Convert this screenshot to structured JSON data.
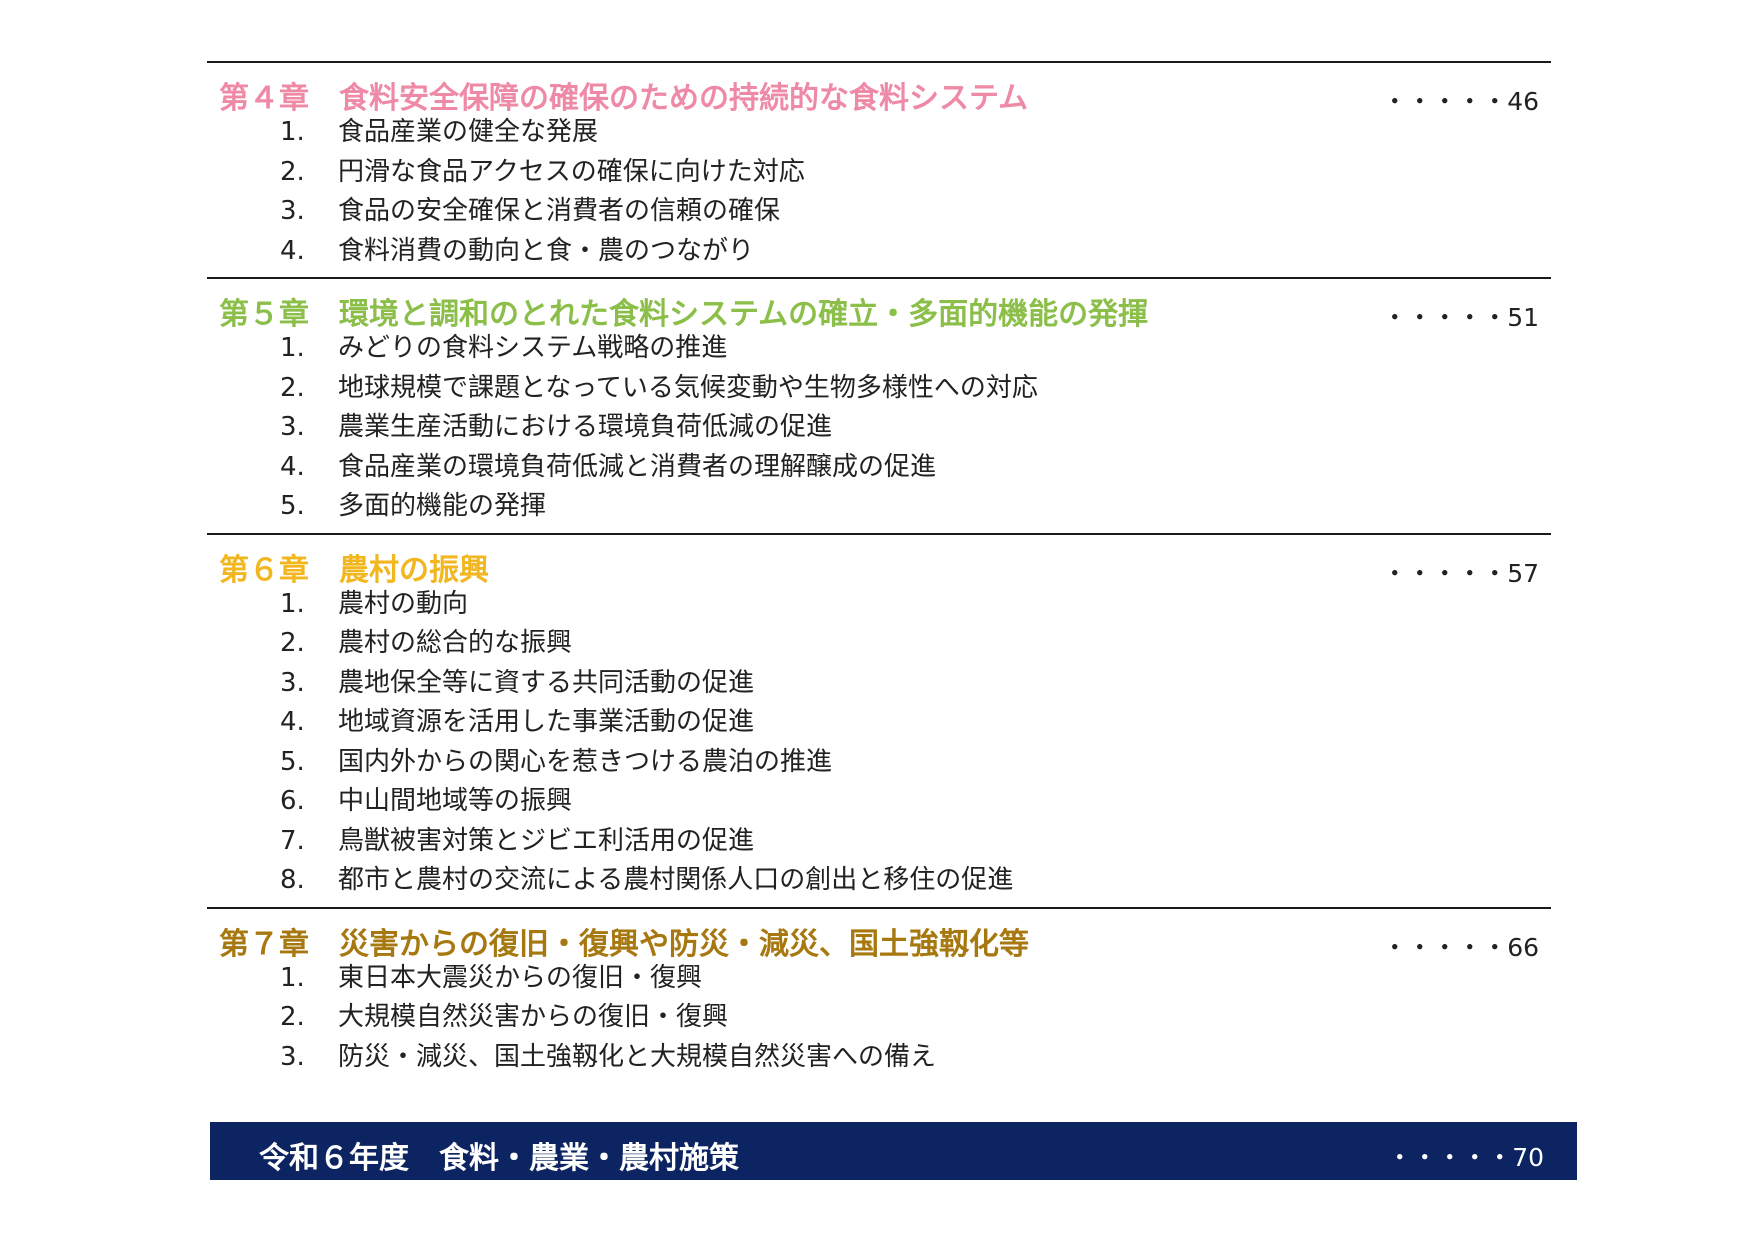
{
  "chapters": [
    {
      "title": "第４章　食料安全保障の確保のための持続的な食料システム",
      "page": "・・・・・46",
      "color": "#ef8aa6",
      "items": [
        {
          "num": "1.",
          "text": "食品産業の健全な発展"
        },
        {
          "num": "2.",
          "text": "円滑な食品アクセスの確保に向けた対応"
        },
        {
          "num": "3.",
          "text": "食品の安全確保と消費者の信頼の確保"
        },
        {
          "num": "4.",
          "text": "食料消費の動向と食・農のつながり"
        }
      ]
    },
    {
      "title": "第５章　環境と調和のとれた食料システムの確立・多面的機能の発揮",
      "page": "・・・・・51",
      "color": "#8cbf4a",
      "items": [
        {
          "num": "1.",
          "text": "みどりの食料システム戦略の推進"
        },
        {
          "num": "2.",
          "text": "地球規模で課題となっている気候変動や生物多様性への対応"
        },
        {
          "num": "3.",
          "text": "農業生産活動における環境負荷低減の促進"
        },
        {
          "num": "4.",
          "text": "食品産業の環境負荷低減と消費者の理解醸成の促進"
        },
        {
          "num": "5.",
          "text": "多面的機能の発揮"
        }
      ]
    },
    {
      "title": "第６章　農村の振興",
      "page": "・・・・・57",
      "color": "#f2b71f",
      "items": [
        {
          "num": "1.",
          "text": "農村の動向"
        },
        {
          "num": "2.",
          "text": "農村の総合的な振興"
        },
        {
          "num": "3.",
          "text": "農地保全等に資する共同活動の促進"
        },
        {
          "num": "4.",
          "text": "地域資源を活用した事業活動の促進"
        },
        {
          "num": "5.",
          "text": "国内外からの関心を惹きつける農泊の推進"
        },
        {
          "num": "6.",
          "text": "中山間地域等の振興"
        },
        {
          "num": "7.",
          "text": "鳥獣被害対策とジビエ利活用の促進"
        },
        {
          "num": "8.",
          "text": "都市と農村の交流による農村関係人口の創出と移住の促進"
        }
      ]
    },
    {
      "title": "第７章　災害からの復旧・復興や防災・減災、国土強靱化等",
      "page": "・・・・・66",
      "color": "#a7780f",
      "items": [
        {
          "num": "1.",
          "text": "東日本大震災からの復旧・復興"
        },
        {
          "num": "2.",
          "text": "大規模自然災害からの復旧・復興"
        },
        {
          "num": "3.",
          "text": "防災・減災、国土強靱化と大規模自然災害への備え"
        }
      ]
    }
  ],
  "policy": {
    "title": "令和６年度　食料・農業・農村施策",
    "page": "・・・・・70",
    "background": "#0c2461"
  }
}
